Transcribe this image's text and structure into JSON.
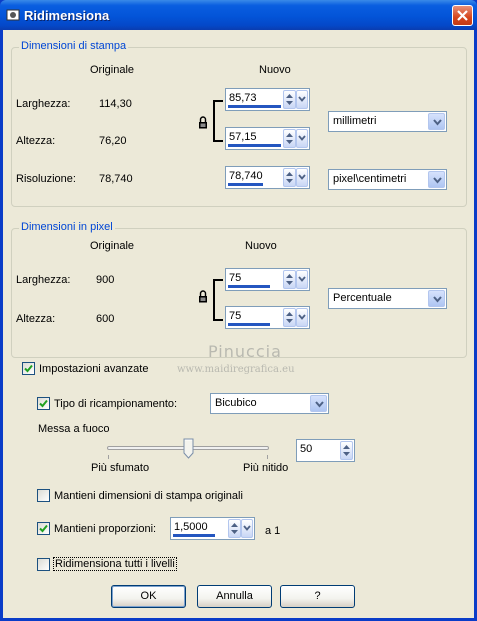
{
  "window": {
    "title": "Ridimensiona"
  },
  "print_dimensions": {
    "group_title": "Dimensioni di stampa",
    "col_original": "Originale",
    "col_new": "Nuovo",
    "width_label": "Larghezza:",
    "width_original": "114,30",
    "width_new": "85,73",
    "height_label": "Altezza:",
    "height_original": "76,20",
    "height_new": "57,15",
    "resolution_label": "Risoluzione:",
    "resolution_original": "78,740",
    "resolution_new": "78,740",
    "unit_select": "millimetri",
    "resolution_unit_select": "pixel\\centimetri"
  },
  "pixel_dimensions": {
    "group_title": "Dimensioni in pixel",
    "col_original": "Originale",
    "col_new": "Nuovo",
    "width_label": "Larghezza:",
    "width_original": "900",
    "width_new": "75",
    "height_label": "Altezza:",
    "height_original": "600",
    "height_new": "75",
    "unit_select": "Percentuale"
  },
  "watermark": {
    "name": "Pinuccia",
    "url": "www.maidiregrafica.eu"
  },
  "advanced": {
    "advanced_label": "Impostazioni avanzate",
    "advanced_checked": true,
    "resample_label": "Tipo di ricampionamento:",
    "resample_checked": true,
    "resample_select": "Bicubico",
    "sharpen_label": "Messa a fuoco",
    "sharpen_value": "50",
    "slider_min_label": "Più sfumato",
    "slider_max_label": "Più nitido",
    "keep_print_label": "Mantieni dimensioni di stampa originali",
    "keep_print_checked": false,
    "keep_ratio_label": "Mantieni proporzioni:",
    "keep_ratio_checked": true,
    "ratio_value": "1,5000",
    "ratio_suffix": "a 1",
    "resize_layers_label": "Ridimensiona tutti i livelli",
    "resize_layers_checked": false
  },
  "buttons": {
    "ok": "OK",
    "cancel": "Annulla",
    "help": "?"
  }
}
